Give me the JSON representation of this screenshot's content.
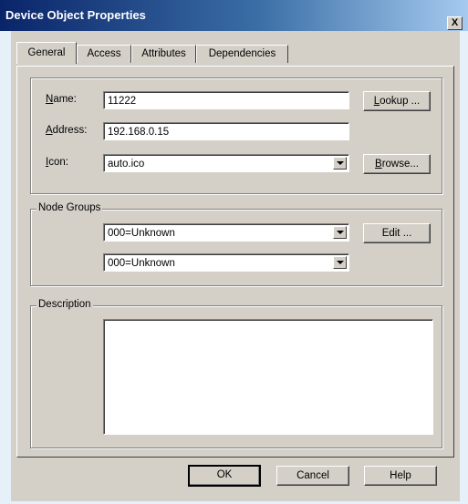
{
  "window": {
    "title": "Device Object Properties",
    "close_glyph": "X"
  },
  "tabs": [
    {
      "label": "General",
      "active": true
    },
    {
      "label": "Access",
      "active": false
    },
    {
      "label": "Attributes",
      "active": false
    },
    {
      "label": "Dependencies",
      "active": false
    }
  ],
  "general": {
    "name_label_key": "N",
    "name_label_rest": "ame:",
    "name_value": "11222",
    "address_label_key": "A",
    "address_label_rest": "ddress:",
    "address_value": "192.168.0.15",
    "icon_label_key": "I",
    "icon_label_rest": "con:",
    "icon_value": "auto.ico",
    "lookup_key": "L",
    "lookup_rest": "ookup ...",
    "browse_key": "B",
    "browse_rest": "rowse..."
  },
  "node_groups": {
    "legend": "Node Groups",
    "group1": "000=Unknown",
    "group2": "000=Unknown",
    "edit_label": "Edit ..."
  },
  "description": {
    "legend": "Description",
    "value": ""
  },
  "footer": {
    "ok": "OK",
    "cancel": "Cancel",
    "help": "Help"
  }
}
